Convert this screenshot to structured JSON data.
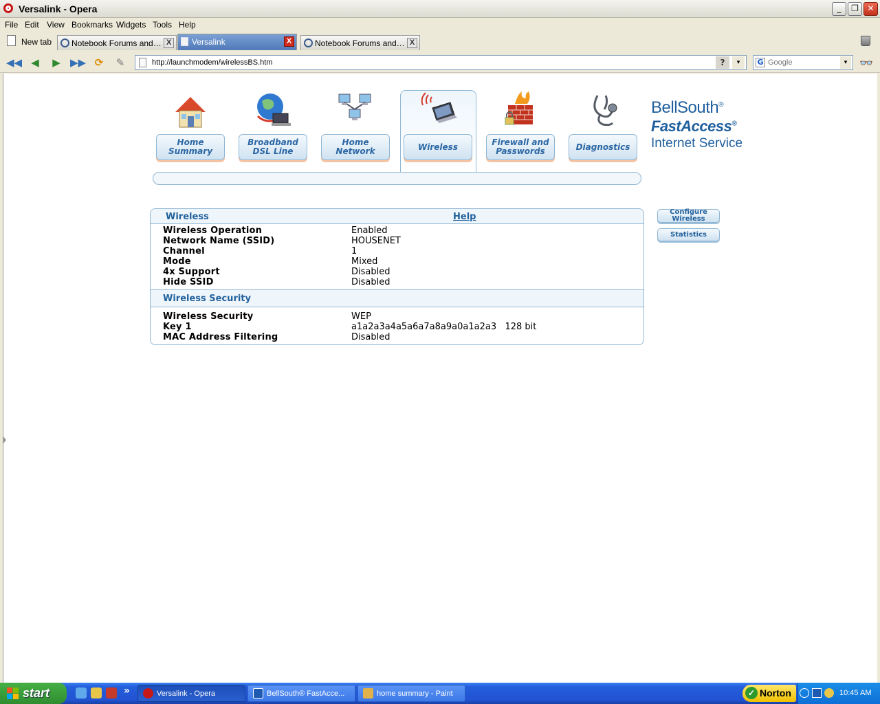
{
  "window": {
    "title": "Versalink - Opera",
    "buttons": {
      "minimize": "_",
      "restore": "❐",
      "close": "✕"
    }
  },
  "menu": [
    "File",
    "Edit",
    "View",
    "Bookmarks",
    "Widgets",
    "Tools",
    "Help"
  ],
  "tabs": {
    "new_tab_label": "New tab",
    "items": [
      {
        "label": "Notebook Forums and La...",
        "active": false
      },
      {
        "label": "Versalink",
        "active": true
      },
      {
        "label": "Notebook Forums and La...",
        "active": false
      }
    ],
    "close_glyph": "X"
  },
  "navbar": {
    "back_all": "◀◀",
    "back": "◀",
    "forward": "▶",
    "fast_forward": "▶▶",
    "reload": "⟳",
    "edit": "✎",
    "url": "http://launchmodem/wirelessBS.htm",
    "help_glyph": "?",
    "dropdown_glyph": "▾",
    "search_engine_glyph": "G",
    "search_placeholder": "Google",
    "binoculars_glyph": "👓"
  },
  "page": {
    "nav_buttons": [
      {
        "line1": "Home",
        "line2": "Summary",
        "icon": "house-icon"
      },
      {
        "line1": "Broadband",
        "line2": "DSL Line",
        "icon": "globe-laptop-icon"
      },
      {
        "line1": "Home",
        "line2": "Network",
        "icon": "network-computers-icon"
      },
      {
        "line1": "Wireless",
        "line2": "",
        "icon": "wireless-laptop-icon"
      },
      {
        "line1": "Firewall and",
        "line2": "Passwords",
        "icon": "firewall-lock-icon"
      },
      {
        "line1": "Diagnostics",
        "line2": "",
        "icon": "stethoscope-icon"
      }
    ],
    "brand": {
      "line1": "BellSouth",
      "line2": "FastAccess",
      "line3": "Internet Service",
      "reg": "®"
    },
    "panel": {
      "title": "Wireless",
      "help_label": "Help",
      "wireless_rows": [
        {
          "key": "Wireless Operation",
          "value": "Enabled"
        },
        {
          "key": "Network Name (SSID)",
          "value": "HOUSENET"
        },
        {
          "key": "Channel",
          "value": "1"
        },
        {
          "key": "Mode",
          "value": "Mixed"
        },
        {
          "key": "4x Support",
          "value": "Disabled"
        },
        {
          "key": "Hide SSID",
          "value": "Disabled"
        }
      ],
      "security_title": "Wireless Security",
      "security_rows": [
        {
          "key": "Wireless Security",
          "value": "WEP"
        },
        {
          "key": "Key 1",
          "value": "a1a2a3a4a5a6a7a8a9a0a1a2a3   128 bit"
        },
        {
          "key": "MAC Address Filtering",
          "value": "Disabled"
        }
      ]
    },
    "side_buttons": {
      "configure_line1": "Configure",
      "configure_line2": "Wireless",
      "statistics": "Statistics"
    }
  },
  "taskbar": {
    "start_label": "start",
    "quicklaunch_more": "»",
    "windows": [
      {
        "label": "Versalink - Opera",
        "active": true
      },
      {
        "label": "BellSouth® FastAcce...",
        "active": false
      },
      {
        "label": "home summary - Paint",
        "active": false
      }
    ],
    "norton_label": "Norton",
    "clock": "10:45 AM"
  }
}
